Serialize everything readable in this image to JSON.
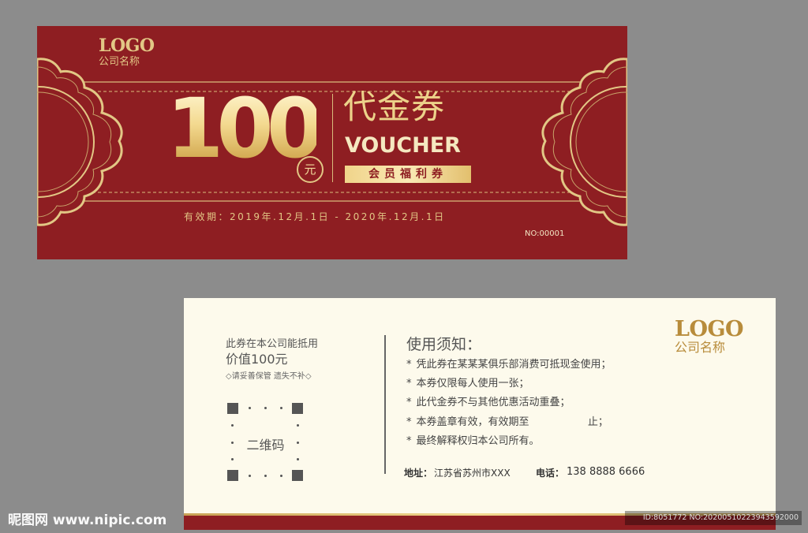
{
  "front": {
    "logo_text": "LOGO",
    "company_name": "公司名称",
    "amount": "100",
    "unit": "元",
    "title_cn": "代金券",
    "title_en": "VOUCHER",
    "badge": "会员福利券",
    "validity": "有效期：2019年.12月.1日 - 2020年.12月.1日",
    "serial": "NO:00001"
  },
  "back": {
    "offset_text": "此券在本公司能抵用",
    "value_text": "价值100元",
    "keep_text": "◇请妥善保管 遗失不补◇",
    "qr_label": "二维码",
    "notice_title": "使用须知：",
    "rules": [
      "凭此券在某某某俱乐部消费可抵现金使用；",
      "本券仅限每人使用一张；",
      "此代金券不与其他优惠活动重叠；",
      "本券盖章有效，有效期至                  止；",
      "最终解释权归本公司所有。"
    ],
    "bullet": "*",
    "address_label": "地址：",
    "address_value": "江苏省苏州市XXX",
    "phone_label": "电话：",
    "phone_value": "138 8888 6666",
    "logo_text": "LOGO",
    "company_name": "公司名称"
  },
  "watermark": {
    "site": "昵图网 www.nipic.com",
    "id_text": "ID:8051772 NO:20200510223943592000"
  },
  "colors": {
    "front_bg": "#8e1e22",
    "gold": "#e2c785",
    "back_bg": "#fdfaec",
    "page_bg": "#8c8c8c"
  }
}
